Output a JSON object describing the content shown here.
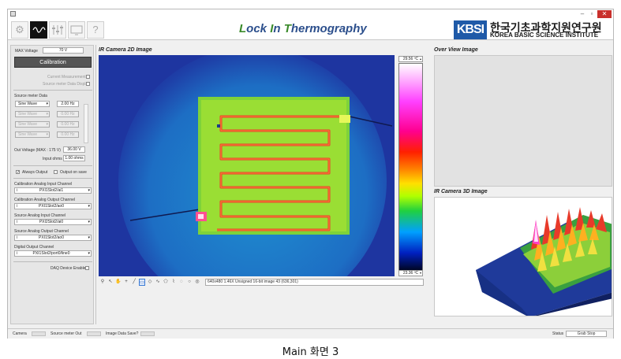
{
  "window": {
    "title": "Lock In Thermography",
    "title_parts": {
      "l": "L",
      "ock": "ock ",
      "i": "I",
      "n": "n ",
      "t": "T",
      "hermo": "hermography"
    }
  },
  "toolbar": {
    "buttons": [
      {
        "icon": "gear-icon",
        "state": "inactive"
      },
      {
        "icon": "waveform-icon",
        "state": "active"
      },
      {
        "icon": "sliders-icon",
        "state": "inactive"
      },
      {
        "icon": "monitor-icon",
        "state": "inactive"
      },
      {
        "icon": "help-icon",
        "label": "?",
        "state": "inactive"
      }
    ]
  },
  "logo": {
    "mark": "KBSI",
    "korean": "한국기초과학지원연구원",
    "english": "KOREA BASIC SCIENCE INSTITUTE"
  },
  "left_panel": {
    "max_voltage_label": "MAX Voltage",
    "max_voltage_value": "70 V",
    "calibration_label": "Calibration",
    "current_measurement_label": "Current Measurement",
    "source_meter_display_label": "Source meter Data Display",
    "source_meter_data_label": "Source meter Data",
    "wave_rows": [
      {
        "wave": "Sine Wave",
        "freq": "2.00 Hz",
        "enabled": true
      },
      {
        "wave": "Sine Wave",
        "freq": "0.00 Hz",
        "enabled": false
      },
      {
        "wave": "Sine Wave",
        "freq": "0.00 Hz",
        "enabled": false
      },
      {
        "wave": "Sine Wave",
        "freq": "0.00 Hz",
        "enabled": false
      }
    ],
    "out_voltage_label": "Out Voltage (MAX : 175 V)",
    "out_voltage_value": "36.00 V",
    "input_ohms_label": "Input ohms",
    "input_ohms_value": "1.00 ohms",
    "always_output_label": "Always Output",
    "always_output_checked": true,
    "output_on_save_label": "Output on save",
    "output_on_save_checked": false,
    "channels": [
      {
        "label": "Calibration Analog Input Channel",
        "value": "PXI1Slot2/ai1"
      },
      {
        "label": "Calibration Analog Output Channel",
        "value": "PXI1Slot2/ao0"
      },
      {
        "label": "Source Analog Input Channel",
        "value": "PXI2Slot2/ai0"
      },
      {
        "label": "Source Analog Output Channel",
        "value": "PXI1Slot2/ao0"
      },
      {
        "label": "Digital Output Channel",
        "value": "PXI1Slot2/port0/line0"
      }
    ],
    "daq_label": "DAQ Device Enable"
  },
  "ir2d": {
    "title": "IR Camera 2D Image",
    "scale_max": "29.56 ºC",
    "scale_min": "23.36 ºC",
    "info": "640x480 1.46X Unsigned 16-bit image 43   (636,301)"
  },
  "overview": {
    "title": "Over View Image"
  },
  "ir3d": {
    "title": "IR Camera 3D Image"
  },
  "status_bar": {
    "camera_label": "Camera",
    "source_meter_out_label": "Source meter Out",
    "image_save_label": "Image Data Save?",
    "status_label": "Status",
    "status_value": "Grab Stop"
  },
  "caption": "Main 화면 3",
  "colors": {
    "accent": "#2c4f8c",
    "title_initial": "#3a8a2a",
    "logo_blue": "#1f5aa8",
    "close": "#c9302c"
  }
}
